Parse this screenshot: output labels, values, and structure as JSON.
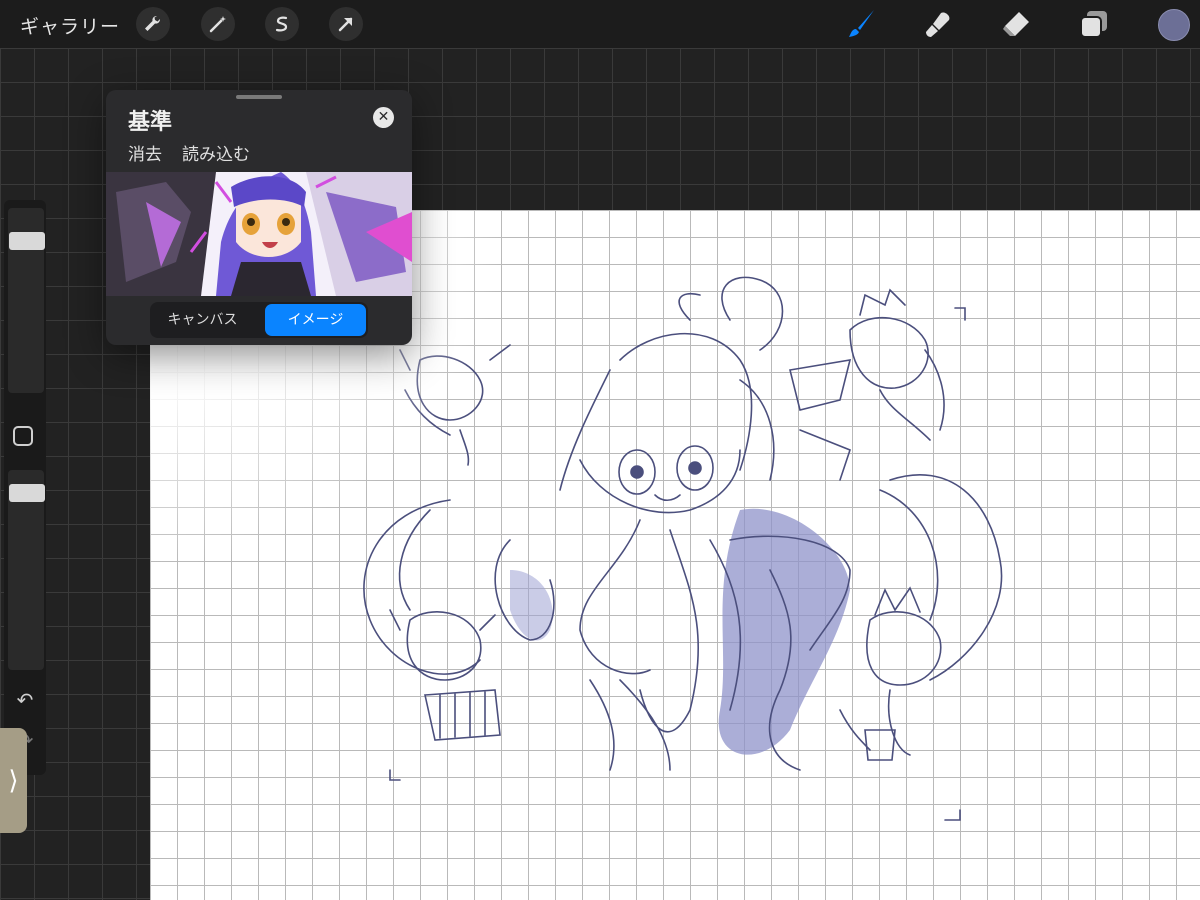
{
  "toolbar": {
    "gallery_label": "ギャラリー",
    "left_tools": [
      {
        "name": "wrench-icon",
        "glyph": "🔧"
      },
      {
        "name": "magic-wand-icon",
        "glyph": "✦"
      },
      {
        "name": "selection-icon",
        "glyph": "S"
      },
      {
        "name": "transform-arrow-icon",
        "glyph": "➚"
      }
    ],
    "right_tools": [
      {
        "name": "brush-icon"
      },
      {
        "name": "smudge-icon"
      },
      {
        "name": "eraser-icon"
      },
      {
        "name": "layers-icon"
      }
    ],
    "active_tool_color": "#0a84ff",
    "current_color": "#6c6f96"
  },
  "sidebar": {
    "modify_icon": "square-icon",
    "undo_glyph": "↶",
    "redo_glyph": "↷",
    "handle_glyph": "⟩"
  },
  "reference_panel": {
    "title": "基準",
    "close_glyph": "✕",
    "actions": [
      "消去",
      "読み込む"
    ],
    "segments": [
      {
        "label": "キャンバス",
        "active": false
      },
      {
        "label": "イメージ",
        "active": true
      }
    ]
  }
}
